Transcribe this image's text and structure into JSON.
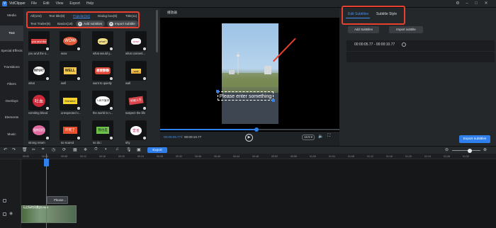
{
  "app": {
    "name": "VidClipper",
    "menu": [
      "File",
      "Edit",
      "View",
      "Export",
      "Help"
    ]
  },
  "sidebar": {
    "items": [
      "Media",
      "Text",
      "Special Effects",
      "Transitions",
      "Filters",
      "Overlays",
      "Elements",
      "Music"
    ],
    "active_index": 1
  },
  "library": {
    "tabs_row1": [
      "All(104)",
      "Text title(8)",
      "Popular(52)",
      "Dialog box(8)",
      "Title(11)"
    ],
    "active_tab": "Popular(52)",
    "tabs_row2": [
      "Text Trailer(8)",
      "Basics(18)"
    ],
    "add_subtitles_label": "Add subtitles",
    "import_subtitle_label": "Import subtitle",
    "tiles": [
      {
        "label": "you and the s...",
        "preview": "you and the"
      },
      {
        "label": "wow",
        "preview": "WOW"
      },
      {
        "label": "what would y...",
        "preview": "what?"
      },
      {
        "label": "what cosmeti...",
        "preview": "wow!"
      },
      {
        "label": "what",
        "preview": "WHAT"
      },
      {
        "label": "well",
        "preview": "WELL"
      },
      {
        "label": "want to quietly",
        "preview": "想要静静"
      },
      {
        "label": "wall",
        "preview": "wall"
      },
      {
        "label": "vomiting blood",
        "preview": "吐血"
      },
      {
        "label": "unexpected c...",
        "preview": "Hahaha!"
      },
      {
        "label": "the world is n...",
        "preview": "人间不值得"
      },
      {
        "label": "suspect the life",
        "preview": "怀疑人生"
      },
      {
        "label": "strong return",
        "preview": "强势回归"
      },
      {
        "label": "so scared",
        "preview": "吓死了"
      },
      {
        "label": "so do i",
        "preview": "我也是"
      },
      {
        "label": "shy",
        "preview": "害羞"
      }
    ]
  },
  "player": {
    "header": "播放器",
    "subtitle_placeholder": "Please enter something",
    "current_time": "00:00:05.77",
    "total_time": "00:00:10.77",
    "ratio": "16:9",
    "progress": 0.536
  },
  "subtitles_panel": {
    "tabs": [
      "Edit Subtitles",
      "Subtitle Style"
    ],
    "active_tab": "Edit Subtitles",
    "add_button": "Add Subtitles",
    "import_button": "Import subtitle",
    "entry_time": "00:00:05.77 - 00:00:10.77",
    "export_button": "Export subtitles"
  },
  "timeline": {
    "export_label": "Export",
    "ruler_ticks": [
      "00:00",
      "00:04",
      "00:08",
      "00:12",
      "00:16",
      "00:20",
      "00:24",
      "00:28",
      "00:32",
      "00:36",
      "00:40",
      "00:44",
      "00:48",
      "00:52",
      "00:56",
      "01:00",
      "01:04",
      "01:08",
      "01:12",
      "01:16",
      "01:20",
      "01:24",
      "01:28",
      "01:32"
    ],
    "subtitle_clip": "Please...",
    "video_clip_name": "无边际的风景(2).mp4"
  },
  "colors": {
    "accent": "#2f80ed",
    "highlight": "#e8402e"
  }
}
